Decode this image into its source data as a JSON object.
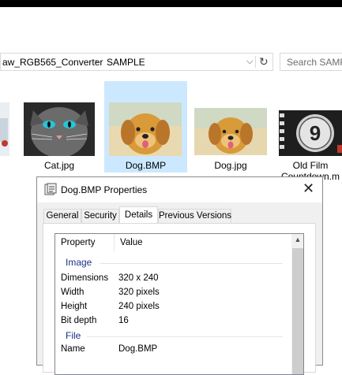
{
  "explorer": {
    "breadcrumb": [
      "aw_RGB565_Converter",
      "SAMPLE"
    ],
    "search_placeholder": "Search SAMP",
    "files": [
      {
        "label": ""
      },
      {
        "label": "Cat.jpg"
      },
      {
        "label": "Dog.BMP"
      },
      {
        "label": "Dog.jpg"
      },
      {
        "label": "Old Film Countdown.m"
      }
    ]
  },
  "dialog": {
    "title": "Dog.BMP Properties",
    "tabs": [
      "General",
      "Security",
      "Details",
      "Previous Versions"
    ],
    "active_tab": "Details",
    "columns": {
      "property": "Property",
      "value": "Value"
    },
    "groups": {
      "image": "Image",
      "file": "File"
    },
    "image_props": [
      {
        "name": "Dimensions",
        "value": "320 x 240"
      },
      {
        "name": "Width",
        "value": "320 pixels"
      },
      {
        "name": "Height",
        "value": "240 pixels"
      },
      {
        "name": "Bit depth",
        "value": "16"
      }
    ],
    "file_props": [
      {
        "name": "Name",
        "value": "Dog.BMP"
      }
    ]
  },
  "colors": {
    "selection": "#cce8ff",
    "group_header": "#1e3287"
  }
}
